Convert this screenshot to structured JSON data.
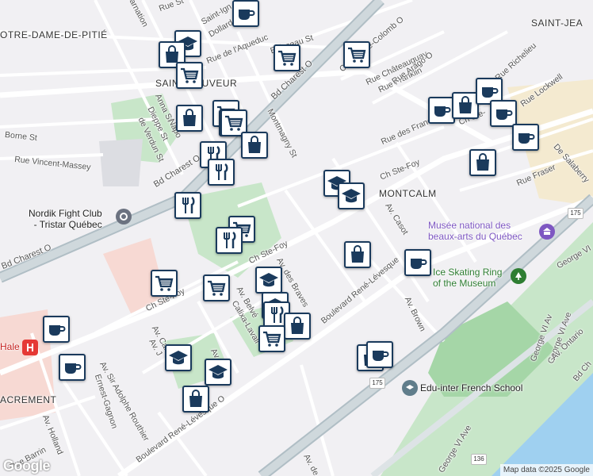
{
  "areas": {
    "notre_dame": "OTRE-DAME-DE-PITIÉ",
    "saint_sauveur": "SAINT-SAUVEUR",
    "saint_jean": "SAINT-JEA",
    "montcalm": "MONTCALM",
    "sacrement": "ACREMENT"
  },
  "streets": {
    "rue_incarnation": "carnation",
    "rue_st": "Rue St",
    "dollard": "Dollard",
    "saint_ignace": "Saint-Ign",
    "rue_laqueduc": "Rue de l'Aqueduc",
    "boisseau": "Boisseau St",
    "bd_charest_o_top": "Bd Charest O",
    "christophe_colomb": "Christophe-Colomb O",
    "chateauguay": "Rue Châteauguay",
    "franklin": "Rue Franklin",
    "arago": "Rue Arago O",
    "anna": "Anna St",
    "dieppe": "Dieppe St",
    "napo": "Napo",
    "verdun": "de Verdun St",
    "borne": "Borne St",
    "vincent_massey": "Rue Vincent-Massey",
    "montmagny": "Montmagny St",
    "bd_charest_o_mid": "Bd Charest O",
    "bd_charest_o_left": "Bd Charest O",
    "rue_des_franciscains": "Rue des Francis",
    "ch_ste_foy_1": "Ch Ste-",
    "ch_ste_foy_2": "Ch Ste-Foy",
    "ch_ste_foy_3": "Ch Ste-Foy",
    "ch_ste_foy_4": "Ch Ste-Foy",
    "richelieu": "Rue Richelieu",
    "lockwell": "Rue Lockwell",
    "salaberry": "De Salaberry",
    "fraser": "Rue Fraser",
    "casot": "Av. Casot",
    "rene_levesque": "Boulevard René-Lévesque",
    "rene_levesque_o": "Boulevard René-Lévesque O",
    "braves": "Av. des Braves",
    "belvedere": "Av. Belvé",
    "calixa": "Calixa-Lavall",
    "cardinal": "Av. Cardinal",
    "av_j": "Av. J",
    "av_d": "Av. D",
    "sir_adolphe": "Av. Sir Adolphe Routhier",
    "ernest": "Ernest-Gagnon",
    "holland": "Av. Holland",
    "barrin": "Rue Barrin",
    "brown": "Av. Brown",
    "george_vi_ave": "George VI Ave",
    "george_vi_av": "George VI Av",
    "george_vi_ave_bottom": "George VI Ave",
    "ontario": "Av. Ontario",
    "av_de": "Av. de",
    "george_vi_right": "George VI",
    "bd_ch": "Bd Ch"
  },
  "route_shields": {
    "r175_top": "175",
    "r175_bottom": "175",
    "r136": "136"
  },
  "pois": {
    "nordik": "Nordik Fight Club\n- Tristar Québec",
    "musee": "Musée national des\nbeaux-arts du Québec",
    "skating": "Ice Skating Ring\nof the Museum",
    "edu_inter": "Edu-inter French School",
    "hale": "Hale"
  },
  "markers": [
    {
      "icon": "coffee-icon",
      "cat": "cafe"
    },
    {
      "icon": "school-icon",
      "cat": "school"
    },
    {
      "icon": "bag-icon",
      "cat": "shop"
    },
    {
      "icon": "cart-icon",
      "cat": "grocery"
    },
    {
      "icon": "cart-icon",
      "cat": "grocery"
    },
    {
      "icon": "cart-icon",
      "cat": "grocery"
    },
    {
      "icon": "cart-icon",
      "cat": "grocery"
    },
    {
      "icon": "cart-icon",
      "cat": "grocery"
    },
    {
      "icon": "bag-icon",
      "cat": "shop"
    },
    {
      "icon": "cart-icon",
      "cat": "grocery"
    },
    {
      "icon": "bag-icon",
      "cat": "shop"
    },
    {
      "icon": "fork-knife-icon",
      "cat": "restaurant"
    },
    {
      "icon": "fork-knife-icon",
      "cat": "restaurant"
    },
    {
      "icon": "fork-knife-icon",
      "cat": "restaurant"
    },
    {
      "icon": "cart-icon",
      "cat": "grocery"
    },
    {
      "icon": "fork-knife-icon",
      "cat": "restaurant"
    },
    {
      "icon": "school-icon",
      "cat": "school"
    },
    {
      "icon": "school-icon",
      "cat": "school"
    },
    {
      "icon": "coffee-icon",
      "cat": "cafe"
    },
    {
      "icon": "bag-icon",
      "cat": "shop"
    },
    {
      "icon": "coffee-icon",
      "cat": "cafe"
    },
    {
      "icon": "coffee-icon",
      "cat": "cafe"
    },
    {
      "icon": "coffee-icon",
      "cat": "cafe"
    },
    {
      "icon": "bag-icon",
      "cat": "shop"
    },
    {
      "icon": "bag-icon",
      "cat": "shop"
    },
    {
      "icon": "coffee-icon",
      "cat": "cafe"
    },
    {
      "icon": "cart-icon",
      "cat": "grocery"
    },
    {
      "icon": "cart-icon",
      "cat": "grocery"
    },
    {
      "icon": "school-icon",
      "cat": "school"
    },
    {
      "icon": "school-icon",
      "cat": "school"
    },
    {
      "icon": "fork-knife-icon",
      "cat": "restaurant"
    },
    {
      "icon": "bag-icon",
      "cat": "shop"
    },
    {
      "icon": "cart-icon",
      "cat": "grocery"
    },
    {
      "icon": "coffee-icon",
      "cat": "cafe"
    },
    {
      "icon": "coffee-icon",
      "cat": "cafe"
    },
    {
      "icon": "school-icon",
      "cat": "school"
    },
    {
      "icon": "school-icon",
      "cat": "school"
    },
    {
      "icon": "bag-icon",
      "cat": "shop"
    },
    {
      "icon": "bag-icon",
      "cat": "shop"
    },
    {
      "icon": "coffee-icon",
      "cat": "cafe"
    }
  ],
  "google_logo": "Google",
  "attribution": "Map data ©2025 Google"
}
